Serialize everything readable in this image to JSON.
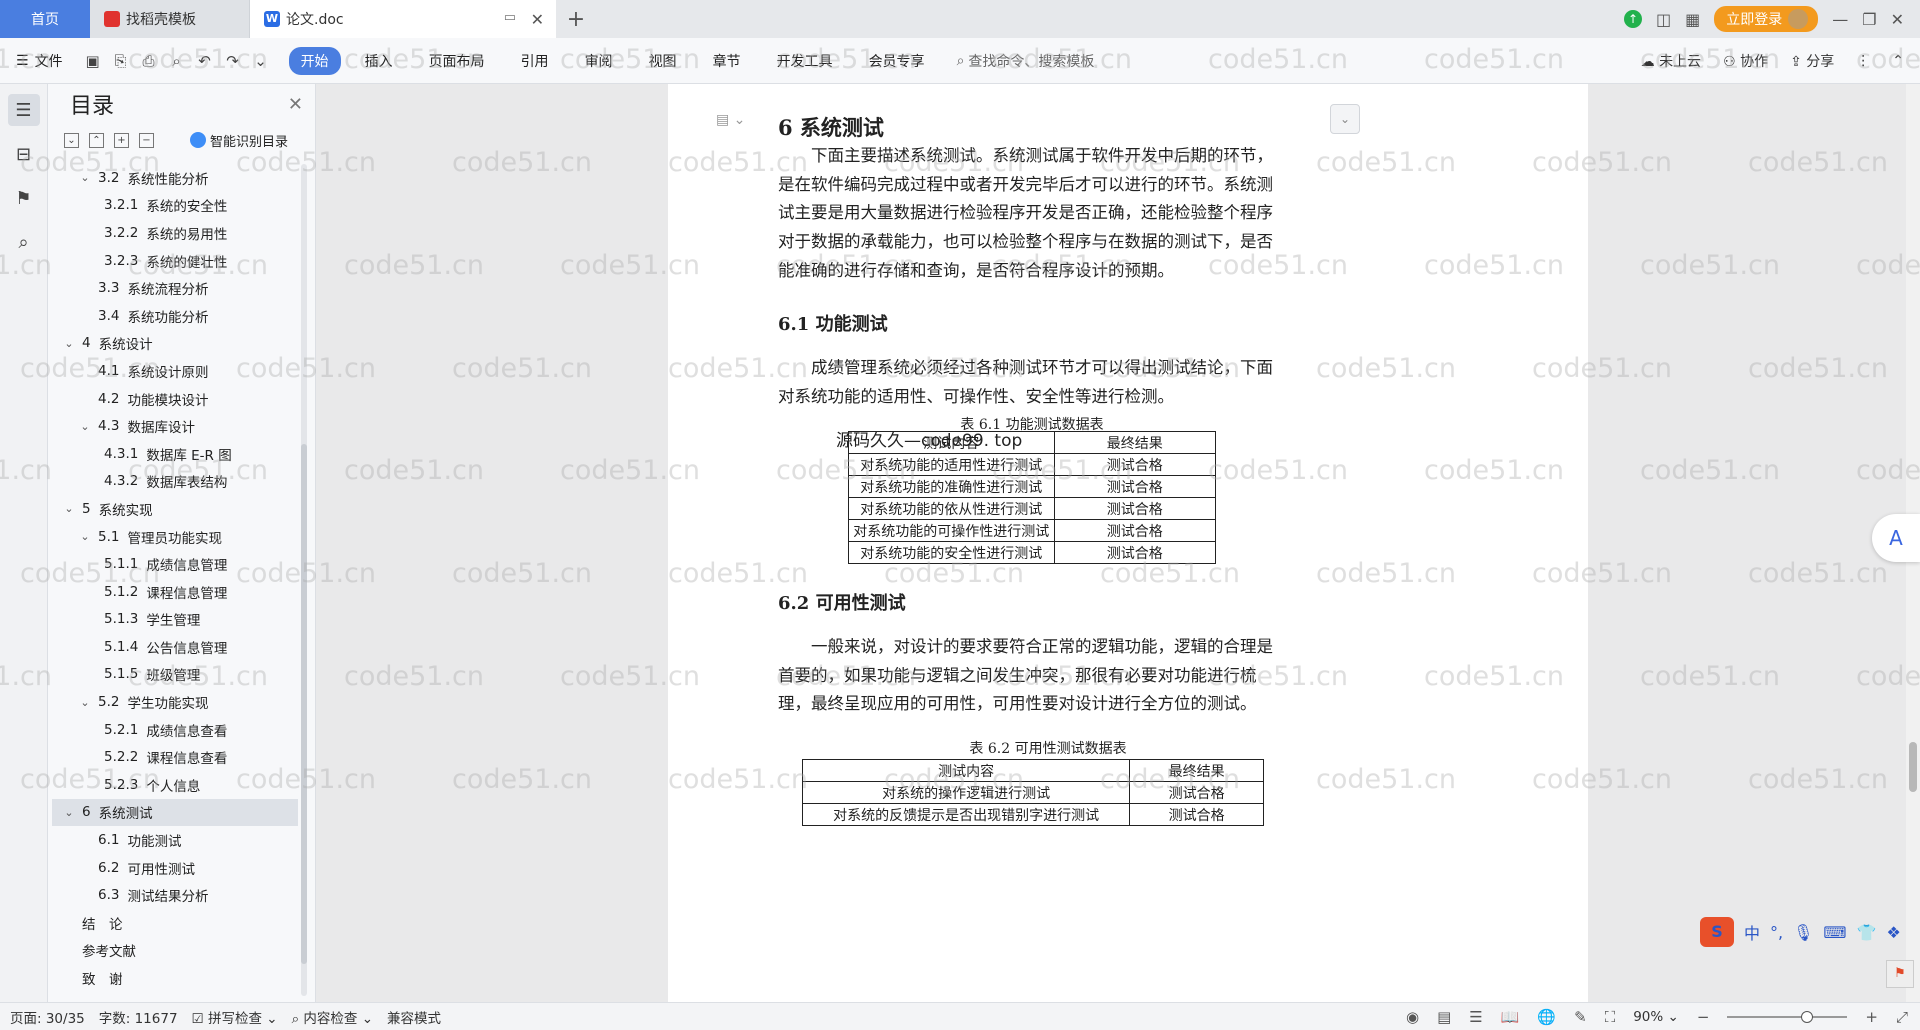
{
  "tabs": {
    "home": "首页",
    "tab1": "找稻壳模板",
    "tab2": "论文.doc"
  },
  "top_right": {
    "login": "立即登录"
  },
  "ribbon": {
    "file_menu": "文件",
    "tabs": [
      "开始",
      "插入",
      "页面布局",
      "引用",
      "审阅",
      "视图",
      "章节",
      "开发工具",
      "会员专享"
    ],
    "search_placeholder": "查找命令、搜索模板",
    "cloud": "未上云",
    "collab": "协作",
    "share": "分享"
  },
  "toc": {
    "title": "目录",
    "ai_label": "智能识别目录",
    "items": [
      {
        "level": 2,
        "num": "3.2",
        "text": "系统性能分析",
        "expanded": true
      },
      {
        "level": 3,
        "num": "3.2.1",
        "text": "系统的安全性"
      },
      {
        "level": 3,
        "num": "3.2.2",
        "text": "系统的易用性"
      },
      {
        "level": 3,
        "num": "3.2.3",
        "text": "系统的健壮性"
      },
      {
        "level": 2,
        "num": "3.3",
        "text": "系统流程分析"
      },
      {
        "level": 2,
        "num": "3.4",
        "text": "系统功能分析"
      },
      {
        "level": 1,
        "num": "4",
        "text": "系统设计",
        "expanded": true
      },
      {
        "level": 2,
        "num": "4.1",
        "text": "系统设计原则"
      },
      {
        "level": 2,
        "num": "4.2",
        "text": "功能模块设计"
      },
      {
        "level": 2,
        "num": "4.3",
        "text": "数据库设计",
        "expanded": true
      },
      {
        "level": 3,
        "num": "4.3.1",
        "text": "数据库 E-R 图"
      },
      {
        "level": 3,
        "num": "4.3.2",
        "text": "数据库表结构"
      },
      {
        "level": 1,
        "num": "5",
        "text": "系统实现",
        "expanded": true
      },
      {
        "level": 2,
        "num": "5.1",
        "text": "管理员功能实现",
        "expanded": true
      },
      {
        "level": 3,
        "num": "5.1.1",
        "text": "成绩信息管理"
      },
      {
        "level": 3,
        "num": "5.1.2",
        "text": "课程信息管理"
      },
      {
        "level": 3,
        "num": "5.1.3",
        "text": "学生管理"
      },
      {
        "level": 3,
        "num": "5.1.4",
        "text": "公告信息管理"
      },
      {
        "level": 3,
        "num": "5.1.5",
        "text": "班级管理"
      },
      {
        "level": 2,
        "num": "5.2",
        "text": "学生功能实现",
        "expanded": true
      },
      {
        "level": 3,
        "num": "5.2.1",
        "text": "成绩信息查看"
      },
      {
        "level": 3,
        "num": "5.2.2",
        "text": "课程信息查看"
      },
      {
        "level": 3,
        "num": "5.2.3",
        "text": "个人信息"
      },
      {
        "level": 1,
        "num": "6",
        "text": "系统测试",
        "expanded": true,
        "selected": true
      },
      {
        "level": 2,
        "num": "6.1",
        "text": "功能测试"
      },
      {
        "level": 2,
        "num": "6.2",
        "text": "可用性测试"
      },
      {
        "level": 2,
        "num": "6.3",
        "text": "测试结果分析"
      },
      {
        "level": 1,
        "num": "",
        "text": "结　论"
      },
      {
        "level": 1,
        "num": "",
        "text": "参考文献"
      },
      {
        "level": 1,
        "num": "",
        "text": "致　谢"
      }
    ]
  },
  "document": {
    "heading": "6  系统测试",
    "intro": "下面主要描述系统测试。系统测试属于软件开发中后期的环节，是在软件编码完成过程中或者开发完毕后才可以进行的环节。系统测试主要是用大量数据进行检验程序开发是否正确，还能检验整个程序对于数据的承载能力，也可以检验整个程序与在数据的测试下，是否能准确的进行存储和查询，是否符合程序设计的预期。",
    "h61": "6.1  功能测试",
    "p61": "成绩管理系统必须经过各种测试环节才可以得出测试结论，下面对系统功能的适用性、可操作性、安全性等进行检测。",
    "table1_caption": "表 6.1  功能测试数据表",
    "overlay": "源码久久—code99. top",
    "table1": {
      "headers": [
        "测试内容",
        "最终结果"
      ],
      "rows": [
        [
          "对系统功能的适用性进行测试",
          "测试合格"
        ],
        [
          "对系统功能的准确性进行测试",
          "测试合格"
        ],
        [
          "对系统功能的依从性进行测试",
          "测试合格"
        ],
        [
          "对系统功能的可操作性进行测试",
          "测试合格"
        ],
        [
          "对系统功能的安全性进行测试",
          "测试合格"
        ]
      ]
    },
    "h62": "6.2  可用性测试",
    "p62": "一般来说，对设计的要求要符合正常的逻辑功能，逻辑的合理是首要的，如果功能与逻辑之间发生冲突，那很有必要对功能进行梳理，最终呈现应用的可用性，可用性要对设计进行全方位的测试。",
    "table2_caption": "表 6.2  可用性测试数据表",
    "table2": {
      "headers": [
        "测试内容",
        "最终结果"
      ],
      "rows": [
        [
          "对系统的操作逻辑进行测试",
          "测试合格"
        ],
        [
          "对系统的反馈提示是否出现错别字进行测试",
          "测试合格"
        ]
      ]
    }
  },
  "watermark": "code51.cn",
  "ime": {
    "logo": "S",
    "lang": "中"
  },
  "statusbar": {
    "page": "页面: 30/35",
    "words": "字数: 11677",
    "spell": "拼写检查",
    "content_check": "内容检查",
    "compat": "兼容模式",
    "zoom": "90%"
  }
}
